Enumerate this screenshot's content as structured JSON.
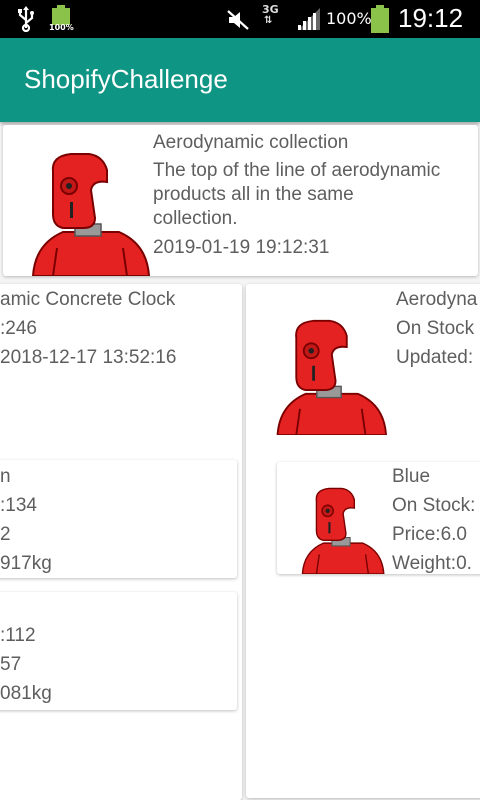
{
  "status_bar": {
    "battery_small_label": "100%",
    "network_type": "3G",
    "battery_percent": "100%",
    "time": "19:12"
  },
  "app_bar": {
    "title": "ShopifyChallenge"
  },
  "collection": {
    "title": "Aerodynamic collection",
    "description_line1": "The top of the line of aerodynamic",
    "description_line2": "products all in the same",
    "description_line3": "collection.",
    "updated": "2019-01-19 19:12:31"
  },
  "left_column": {
    "product_name": "amic Concrete Clock",
    "stock": ":246",
    "updated": "2018-12-17 13:52:16",
    "variants": [
      {
        "name": "n",
        "stock": ":134",
        "price": "2",
        "weight": "917kg"
      },
      {
        "stock": ":112",
        "price": "57",
        "weight": "081kg"
      }
    ]
  },
  "right_column": {
    "product_name": "Aerodyna",
    "stock": "On Stock",
    "updated": "Updated:",
    "variants": [
      {
        "name": "Blue",
        "stock": "On Stock:",
        "price": "Price:6.0",
        "weight": "Weight:0."
      }
    ]
  },
  "colors": {
    "app_bar": "#0f9584",
    "robot_red": "#e52222"
  }
}
